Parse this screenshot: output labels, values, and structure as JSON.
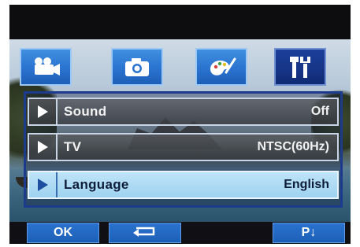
{
  "tabs": [
    {
      "name": "video-camera-icon",
      "active": false
    },
    {
      "name": "camera-icon",
      "active": false
    },
    {
      "name": "palette-icon",
      "active": false
    },
    {
      "name": "settings-tools-icon",
      "active": true
    }
  ],
  "menu": {
    "items": [
      {
        "label": "Sound",
        "value": "Off",
        "selected": false
      },
      {
        "label": "TV",
        "value": "NTSC(60Hz)",
        "selected": false
      },
      {
        "label": "Language",
        "value": "English",
        "selected": true
      }
    ]
  },
  "bottom_bar": {
    "ok_label": "OK",
    "back_icon": "return-arrow-icon",
    "page_label": "P↓"
  },
  "colors": {
    "tab_blue": "#2a73cf",
    "tab_active": "#163486",
    "selected_row": "#9ed2f0"
  }
}
